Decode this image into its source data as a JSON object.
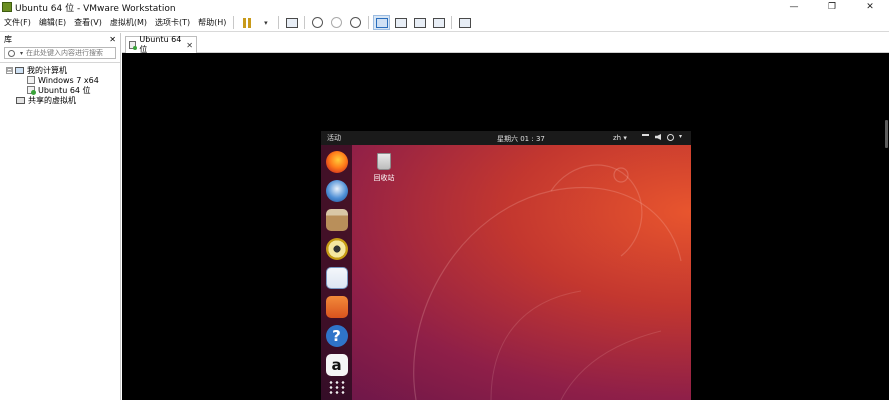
{
  "window": {
    "title": "Ubuntu 64 位 - VMware Workstation",
    "minimize": "—",
    "restore": "❐",
    "close": "✕"
  },
  "menu": {
    "items": [
      "文件(F)",
      "编辑(E)",
      "查看(V)",
      "虚拟机(M)",
      "选项卡(T)",
      "帮助(H)"
    ],
    "caret": "▾"
  },
  "library": {
    "title": "库",
    "close": "✕",
    "search_placeholder": "在此处键入内容进行搜索",
    "tree": {
      "my_computer": "我的计算机",
      "toggle": "⊟",
      "vm1": "Windows 7 x64",
      "vm2": "Ubuntu 64 位",
      "shared": "共享的虚拟机"
    }
  },
  "tabs": [
    {
      "label": "Ubuntu 64 位",
      "close": "✕"
    }
  ],
  "guest": {
    "activities": "活动",
    "clock": "星期六 01 : 37",
    "lang": "zh ▾",
    "menu_caret": "▾",
    "trash_label": "回收站",
    "help_glyph": "?",
    "amazon_glyph": "a"
  },
  "colors": {
    "vm_background": "#000000",
    "ubuntu_orange": "#e8552e",
    "ubuntu_aubergine": "#6a1649",
    "running_green": "#3aa33a"
  }
}
